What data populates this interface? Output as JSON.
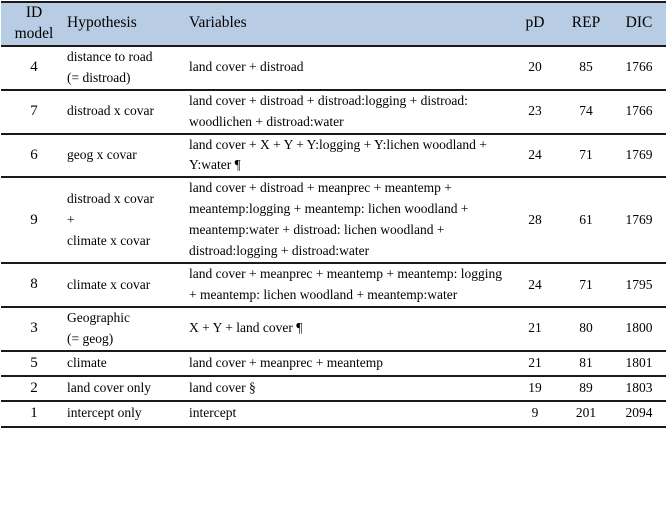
{
  "table": {
    "columns": [
      {
        "key": "id",
        "label_lines": [
          "ID",
          "model"
        ]
      },
      {
        "key": "hyp",
        "label_lines": [
          "Hypothesis"
        ]
      },
      {
        "key": "var",
        "label_lines": [
          "Variables"
        ]
      },
      {
        "key": "pd",
        "label_lines": [
          "pD"
        ]
      },
      {
        "key": "rep",
        "label_lines": [
          "REP"
        ]
      },
      {
        "key": "dic",
        "label_lines": [
          "DIC"
        ]
      }
    ],
    "header": {
      "id_line1": "ID",
      "id_line2": "model",
      "hypothesis": "Hypothesis",
      "variables": "Variables",
      "pd": "pD",
      "rep": "REP",
      "dic": "DIC"
    },
    "rows": [
      {
        "id": "4",
        "hypothesis_lines": [
          "distance to road",
          "(= distroad)"
        ],
        "variables": "land cover + distroad",
        "pd": "20",
        "rep": "85",
        "dic": "1766"
      },
      {
        "id": "7",
        "hypothesis_lines": [
          "distroad x covar"
        ],
        "variables": "land cover + distroad + distroad:logging + distroad: woodlichen + distroad:water",
        "pd": "23",
        "rep": "74",
        "dic": "1766"
      },
      {
        "id": "6",
        "hypothesis_lines": [
          "geog x covar"
        ],
        "variables": "land cover + X + Y + Y:logging + Y:lichen woodland + Y:water ¶",
        "pd": "24",
        "rep": "71",
        "dic": "1769"
      },
      {
        "id": "9",
        "hypothesis_lines": [
          "distroad x covar",
          "+",
          "climate x covar"
        ],
        "variables": "land cover + distroad + meanprec + meantemp + meantemp:logging + meantemp: lichen woodland + meantemp:water + distroad: lichen woodland + distroad:logging + distroad:water",
        "pd": "28",
        "rep": "61",
        "dic": "1769"
      },
      {
        "id": "8",
        "hypothesis_lines": [
          "climate x covar"
        ],
        "variables": "land cover + meanprec + meantemp + meantemp: logging + meantemp: lichen woodland + meantemp:water",
        "pd": "24",
        "rep": "71",
        "dic": "1795"
      },
      {
        "id": "3",
        "hypothesis_lines": [
          "Geographic",
          "(= geog)"
        ],
        "variables": "X + Y + land cover ¶",
        "pd": "21",
        "rep": "80",
        "dic": "1800"
      },
      {
        "id": "5",
        "hypothesis_lines": [
          "climate"
        ],
        "variables": "land cover + meanprec + meantemp",
        "pd": "21",
        "rep": "81",
        "dic": "1801"
      },
      {
        "id": "2",
        "hypothesis_lines": [
          "land cover only"
        ],
        "variables": "land cover §",
        "pd": "19",
        "rep": "89",
        "dic": "1803"
      },
      {
        "id": "1",
        "hypothesis_lines": [
          "intercept only"
        ],
        "variables": "intercept",
        "pd": "9",
        "rep": "201",
        "dic": "2094"
      }
    ]
  },
  "colors": {
    "header_background": "#b8cce4",
    "border": "#1a1a1a",
    "text": "#000000",
    "body_background": "#ffffff"
  }
}
